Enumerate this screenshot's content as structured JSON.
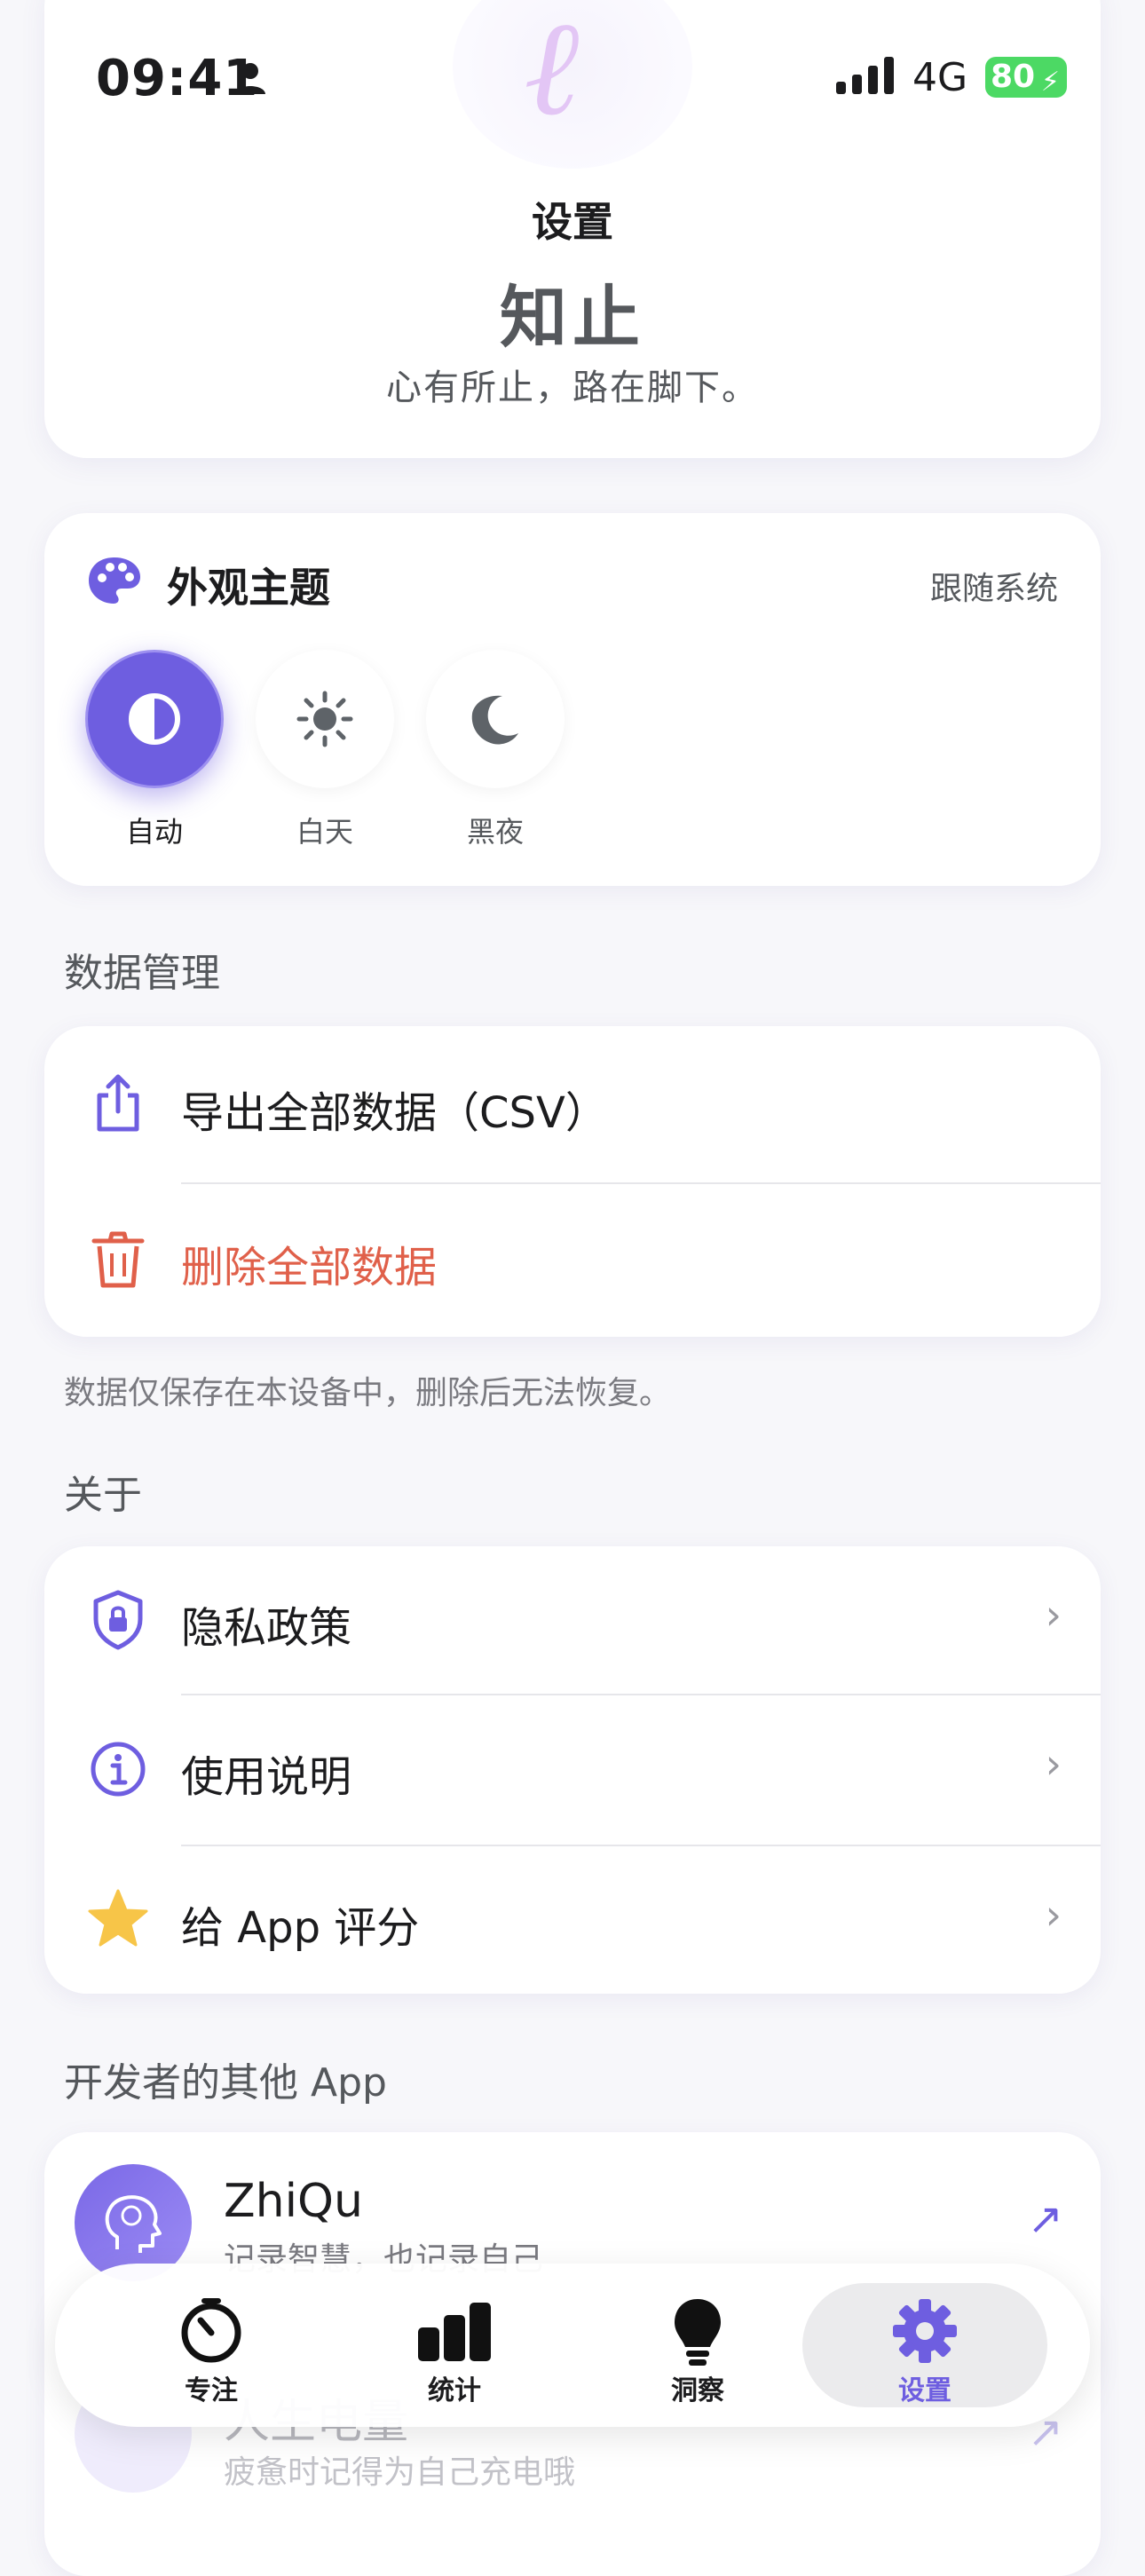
{
  "status_bar": {
    "time": "09:41",
    "network": "4G",
    "battery": "80"
  },
  "header": {
    "page_title": "设置",
    "app_name": "知止",
    "slogan": "心有所止，路在脚下。"
  },
  "theme": {
    "title": "外观主题",
    "current": "跟随系统",
    "options": [
      {
        "label": "自动",
        "icon": "half-circle-icon",
        "active": true
      },
      {
        "label": "白天",
        "icon": "sun-icon",
        "active": false
      },
      {
        "label": "黑夜",
        "icon": "moon-icon",
        "active": false
      }
    ]
  },
  "data_section": {
    "title": "数据管理",
    "export_label": "导出全部数据（CSV）",
    "delete_label": "删除全部数据",
    "footnote": "数据仅保存在本设备中，删除后无法恢复。"
  },
  "about_section": {
    "title": "关于",
    "items": [
      {
        "label": "隐私政策",
        "icon": "shield-lock-icon"
      },
      {
        "label": "使用说明",
        "icon": "info-icon"
      },
      {
        "label": "给 App 评分",
        "icon": "star-icon"
      }
    ]
  },
  "other_apps": {
    "title": "开发者的其他 App",
    "apps": [
      {
        "name": "ZhiQu",
        "desc": "记录智慧，也记录自己"
      },
      {
        "name": "人生电量",
        "desc": "疲惫时记得为自己充电哦"
      }
    ]
  },
  "tabbar": {
    "tabs": [
      {
        "label": "专注",
        "icon": "timer-icon",
        "active": false
      },
      {
        "label": "统计",
        "icon": "bar-chart-icon",
        "active": false
      },
      {
        "label": "洞察",
        "icon": "lightbulb-icon",
        "active": false
      },
      {
        "label": "设置",
        "icon": "gear-icon",
        "active": true
      }
    ]
  },
  "colors": {
    "accent": "#6e5ee0",
    "danger": "#e0604a",
    "star": "#f7c548",
    "background": "#f7f7fa"
  }
}
